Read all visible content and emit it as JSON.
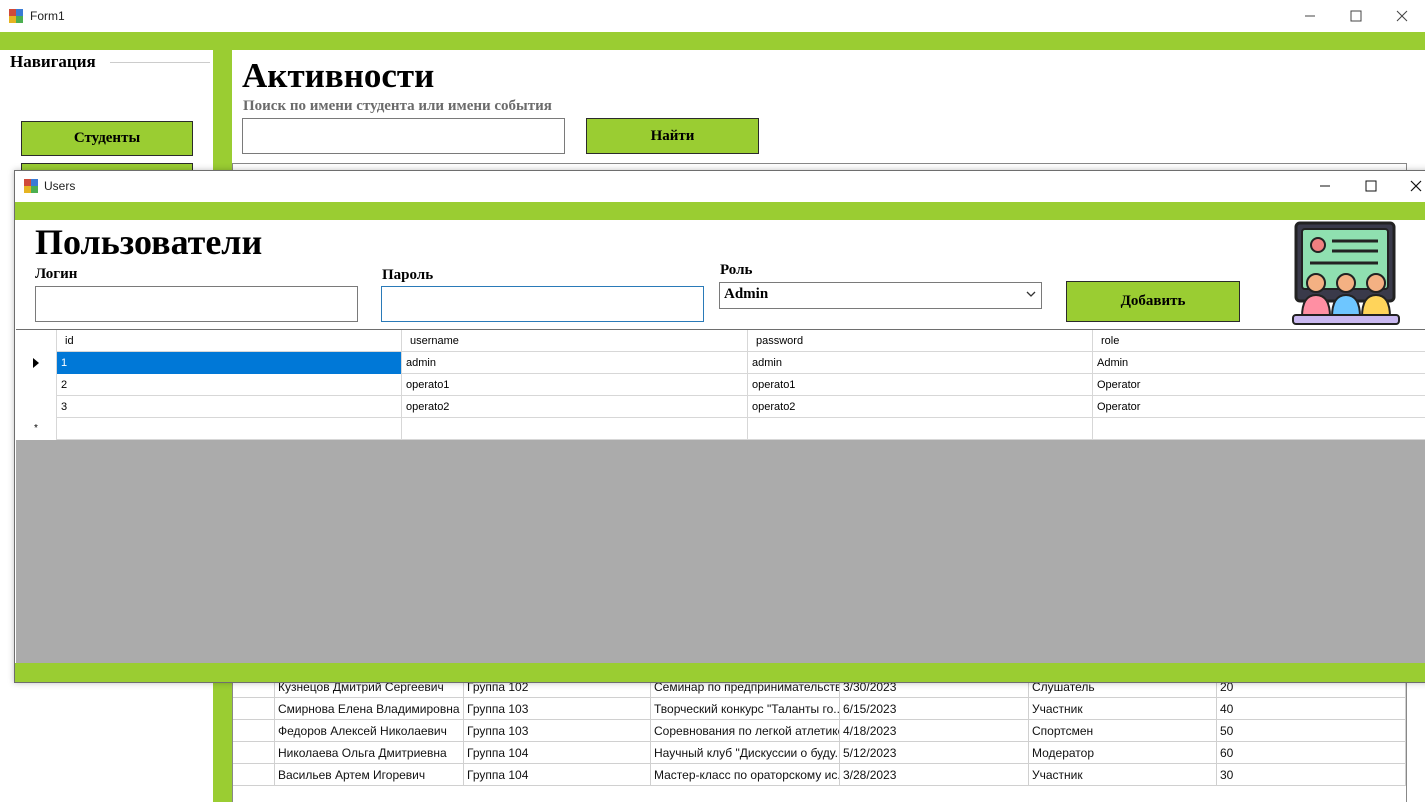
{
  "form1": {
    "title": "Form1",
    "navigation": {
      "title": "Навигация",
      "students_button": "Студенты"
    },
    "activities": {
      "title": "Активности",
      "search_hint": "Поиск по имени студента или имени события",
      "search_value": "",
      "find_button": "Найти",
      "rows": [
        {
          "name": "Кузнецов Дмитрий Сергеевич",
          "group": "Группа 102",
          "event": "Семинар по предпринимательству",
          "date": "3/30/2023",
          "role": "Слушатель",
          "points": "20"
        },
        {
          "name": "Смирнова Елена Владимировна",
          "group": "Группа 103",
          "event": "Творческий конкурс \"Таланты го...",
          "date": "6/15/2023",
          "role": "Участник",
          "points": "40"
        },
        {
          "name": "Федоров Алексей Николаевич",
          "group": "Группа 103",
          "event": "Соревнования по легкой атлетике",
          "date": "4/18/2023",
          "role": "Спортсмен",
          "points": "50"
        },
        {
          "name": "Николаева Ольга Дмитриевна",
          "group": "Группа 104",
          "event": "Научный клуб \"Дискуссии о буду...",
          "date": "5/12/2023",
          "role": "Модератор",
          "points": "60"
        },
        {
          "name": "Васильев Артем Игоревич",
          "group": "Группа 104",
          "event": "Мастер-класс по ораторскому ис...",
          "date": "3/28/2023",
          "role": "Участник",
          "points": "30"
        }
      ]
    }
  },
  "users": {
    "window_title": "Users",
    "title": "Пользователи",
    "login_label": "Логин",
    "login_value": "",
    "password_label": "Пароль",
    "password_value": "",
    "role_label": "Роль",
    "role_selected": "Admin",
    "add_button": "Добавить",
    "grid": {
      "columns": [
        "id",
        "username",
        "password",
        "role"
      ],
      "rows": [
        {
          "id": "1",
          "username": "admin",
          "password": "admin",
          "role": "Admin",
          "current": true
        },
        {
          "id": "2",
          "username": "operato1",
          "password": "operato1",
          "role": "Operator"
        },
        {
          "id": "3",
          "username": "operato2",
          "password": "operato2",
          "role": "Operator"
        }
      ],
      "new_row_marker": "*"
    }
  },
  "colors": {
    "accent_green": "#9acd32",
    "selection_blue": "#0078d7",
    "grid_background": "#ababab"
  },
  "icons": {
    "app_icon": "windows-form-icon",
    "users_illustration": "presentation-board-people-icon"
  }
}
